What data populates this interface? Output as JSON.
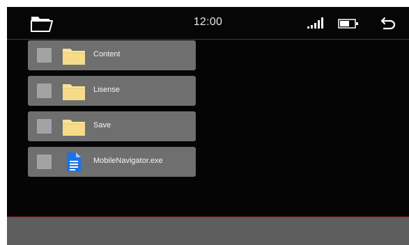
{
  "status_bar": {
    "clock": "12:00",
    "left_icon": "folder-icon",
    "signal_icon": "signal-bars-icon",
    "battery_icon": "battery-icon",
    "back_icon": "back-arrow-icon"
  },
  "files": [
    {
      "label": "Content",
      "icon": "folder-icon"
    },
    {
      "label": "Lisense",
      "icon": "folder-icon"
    },
    {
      "label": "Save",
      "icon": "folder-icon"
    },
    {
      "label": "MobileNavigator.exe",
      "icon": "document-icon"
    }
  ],
  "colors": {
    "background": "#050505",
    "item_background": "#6f6f6f",
    "checkbox": "#a3a3a3",
    "accent_line": "#8a1c1c",
    "folder": "#f9e39a",
    "document": "#1a73e8",
    "bottom_bar": "#5e5e5e"
  }
}
